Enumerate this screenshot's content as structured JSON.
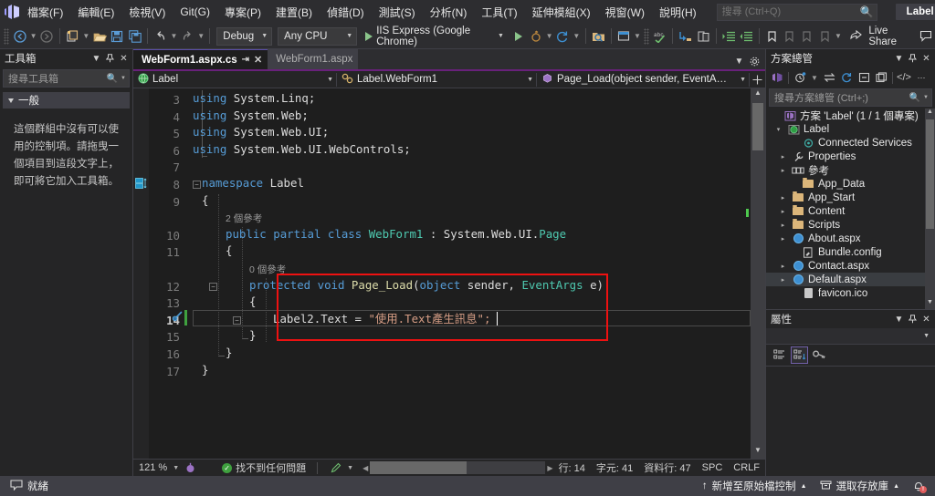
{
  "menubar": {
    "logo_icon": "visual-studio-logo",
    "items": [
      {
        "label": "檔案(F)"
      },
      {
        "label": "編輯(E)"
      },
      {
        "label": "檢視(V)"
      },
      {
        "label": "Git(G)"
      },
      {
        "label": "專案(P)"
      },
      {
        "label": "建置(B)"
      },
      {
        "label": "偵錯(D)"
      },
      {
        "label": "測試(S)"
      },
      {
        "label": "分析(N)"
      },
      {
        "label": "工具(T)"
      },
      {
        "label": "延伸模組(X)"
      },
      {
        "label": "視窗(W)"
      },
      {
        "label": "說明(H)"
      }
    ],
    "search_placeholder": "搜尋 (Ctrl+Q)",
    "search_value": "",
    "search_icon": "search-icon",
    "project_chip": "Label",
    "minimize": "—",
    "maximize": "❐",
    "close": "✕"
  },
  "toolbar": {
    "nav_back_icon": "navigate-back-icon",
    "nav_forward_icon": "navigate-forward-icon",
    "new_project_icon": "new-project-icon",
    "open_icon": "open-file-icon",
    "save_icon": "save-icon",
    "save_all_icon": "save-all-icon",
    "undo_icon": "undo-icon",
    "redo_icon": "redo-icon",
    "configuration": "Debug",
    "platform": "Any CPU",
    "start_label": "IIS Express (Google Chrome)",
    "start_icon": "play-icon",
    "hot_reload_icon": "hot-reload-icon",
    "refresh_icon": "refresh-icon",
    "live_share_label": "Live Share",
    "live_share_icon": "live-share-icon",
    "feedback_icon": "send-feedback-icon"
  },
  "toolbox": {
    "title": "工具箱",
    "dropdown_icon": "chevron-down-icon",
    "pin_icon": "pin-icon",
    "close_icon": "close-icon",
    "search_placeholder": "搜尋工具箱",
    "search_icon": "search-icon",
    "group_label": "一般",
    "empty_message": "這個群組中沒有可以使用的控制項。請拖曳一個項目到這段文字上，即可將它加入工具箱。"
  },
  "editor": {
    "tabs": [
      {
        "label": "WebForm1.aspx.cs",
        "active": true,
        "pin_icon": "pin-icon",
        "close_icon": "close-icon"
      },
      {
        "label": "WebForm1.aspx",
        "active": false
      }
    ],
    "tab_dropdown_icon": "chevron-down-icon",
    "tab_settings_icon": "gear-icon",
    "navbar": {
      "project": "Label",
      "project_icon": "web-project-icon",
      "type": "Label.WebForm1",
      "type_icon": "class-icon",
      "member": "Page_Load(object sender, EventArgs e)",
      "member_icon": "method-icon",
      "split_icon": "split-view-icon"
    },
    "lines": [
      {
        "num": "3",
        "text": "using System.Linq;"
      },
      {
        "num": "4",
        "text": "using System.Web;"
      },
      {
        "num": "5",
        "text": "using System.Web.UI;"
      },
      {
        "num": "6",
        "text": "using System.Web.UI.WebControls;"
      },
      {
        "num": "7",
        "text": ""
      },
      {
        "num": "8",
        "text": "namespace Label"
      },
      {
        "num": "9",
        "text": "{"
      },
      {
        "num": "10",
        "text": "    public partial class WebForm1 : System.Web.UI.Page"
      },
      {
        "num": "11",
        "text": "    {"
      },
      {
        "num": "12",
        "text": "        protected void Page_Load(object sender, EventArgs e)"
      },
      {
        "num": "13",
        "text": "        {"
      },
      {
        "num": "14",
        "text": "            Label2.Text = \"使用.Text產生訊息\";"
      },
      {
        "num": "15",
        "text": "        }"
      },
      {
        "num": "16",
        "text": "    }"
      },
      {
        "num": "17",
        "text": "}"
      }
    ],
    "codelens": [
      {
        "text": "2 個參考"
      },
      {
        "text": "0 個參考"
      }
    ],
    "highlight_color": "#ee1111",
    "status": {
      "zoom": "121 %",
      "zoom_arrow": "chevron-down-icon",
      "issues_icon": "check-circle-icon",
      "issues": "找不到任何問題",
      "pen_icon": "pen-icon",
      "line_label": "行: 14",
      "char_label": "字元: 41",
      "col_label": "資料行: 47",
      "spaces": "SPC",
      "eol": "CRLF"
    }
  },
  "solution_explorer": {
    "title": "方案總管",
    "dropdown_icon": "chevron-down-icon",
    "pin_icon": "pin-icon",
    "close_icon": "close-icon",
    "toolbar_icons": [
      "vs-home-icon",
      "pending-changes-icon",
      "sync-icon",
      "refresh-icon",
      "collapse-all-icon",
      "show-all-files-icon",
      "code-view-icon",
      "overflow-icon"
    ],
    "search_placeholder": "搜尋方案總管 (Ctrl+;)",
    "search_icon": "search-icon",
    "tree": [
      {
        "label": "方案 'Label' (1 / 1 個專案)",
        "indent": 0,
        "icon": "solution-icon",
        "twisty": "",
        "selected": false
      },
      {
        "label": "Label",
        "indent": 1,
        "icon": "project-icon",
        "twisty": "▾",
        "selected": false
      },
      {
        "label": "Connected Services",
        "indent": 2,
        "icon": "connected-services-icon",
        "twisty": "",
        "selected": false
      },
      {
        "label": "Properties",
        "indent": 2,
        "icon": "wrench-icon",
        "twisty": "▸",
        "selected": false
      },
      {
        "label": "參考",
        "indent": 2,
        "icon": "references-icon",
        "twisty": "▸",
        "selected": false
      },
      {
        "label": "App_Data",
        "indent": 2,
        "icon": "folder-icon",
        "twisty": "",
        "selected": false
      },
      {
        "label": "App_Start",
        "indent": 2,
        "icon": "folder-icon",
        "twisty": "▸",
        "selected": false
      },
      {
        "label": "Content",
        "indent": 2,
        "icon": "folder-icon",
        "twisty": "▸",
        "selected": false
      },
      {
        "label": "Scripts",
        "indent": 2,
        "icon": "folder-icon",
        "twisty": "▸",
        "selected": false
      },
      {
        "label": "About.aspx",
        "indent": 2,
        "icon": "aspx-icon",
        "twisty": "▸",
        "selected": false
      },
      {
        "label": "Bundle.config",
        "indent": 2,
        "icon": "config-icon",
        "twisty": "",
        "selected": false
      },
      {
        "label": "Contact.aspx",
        "indent": 2,
        "icon": "aspx-icon",
        "twisty": "▸",
        "selected": false
      },
      {
        "label": "Default.aspx",
        "indent": 2,
        "icon": "aspx-icon",
        "twisty": "▸",
        "selected": true
      },
      {
        "label": "favicon.ico",
        "indent": 2,
        "icon": "file-icon",
        "twisty": "",
        "selected": false
      }
    ]
  },
  "properties": {
    "title": "屬性",
    "dropdown_icon": "chevron-down-icon",
    "pin_icon": "pin-icon",
    "close_icon": "close-icon",
    "categorized_icon": "categorized-view-icon",
    "alphabetical_icon": "alphabetical-view-icon",
    "events_icon": "events-key-icon"
  },
  "statusbar": {
    "ready_icon": "ready-icon",
    "ready": "就緒",
    "source_control_icon": "arrow-up-icon",
    "source_control": "新增至原始檔控制",
    "source_control_arrow": "chevron-up-icon",
    "repo_icon": "repository-icon",
    "repo": "選取存放庫",
    "repo_arrow": "chevron-up-icon",
    "notifications_icon": "bell-icon",
    "notifications_badge": "!"
  }
}
